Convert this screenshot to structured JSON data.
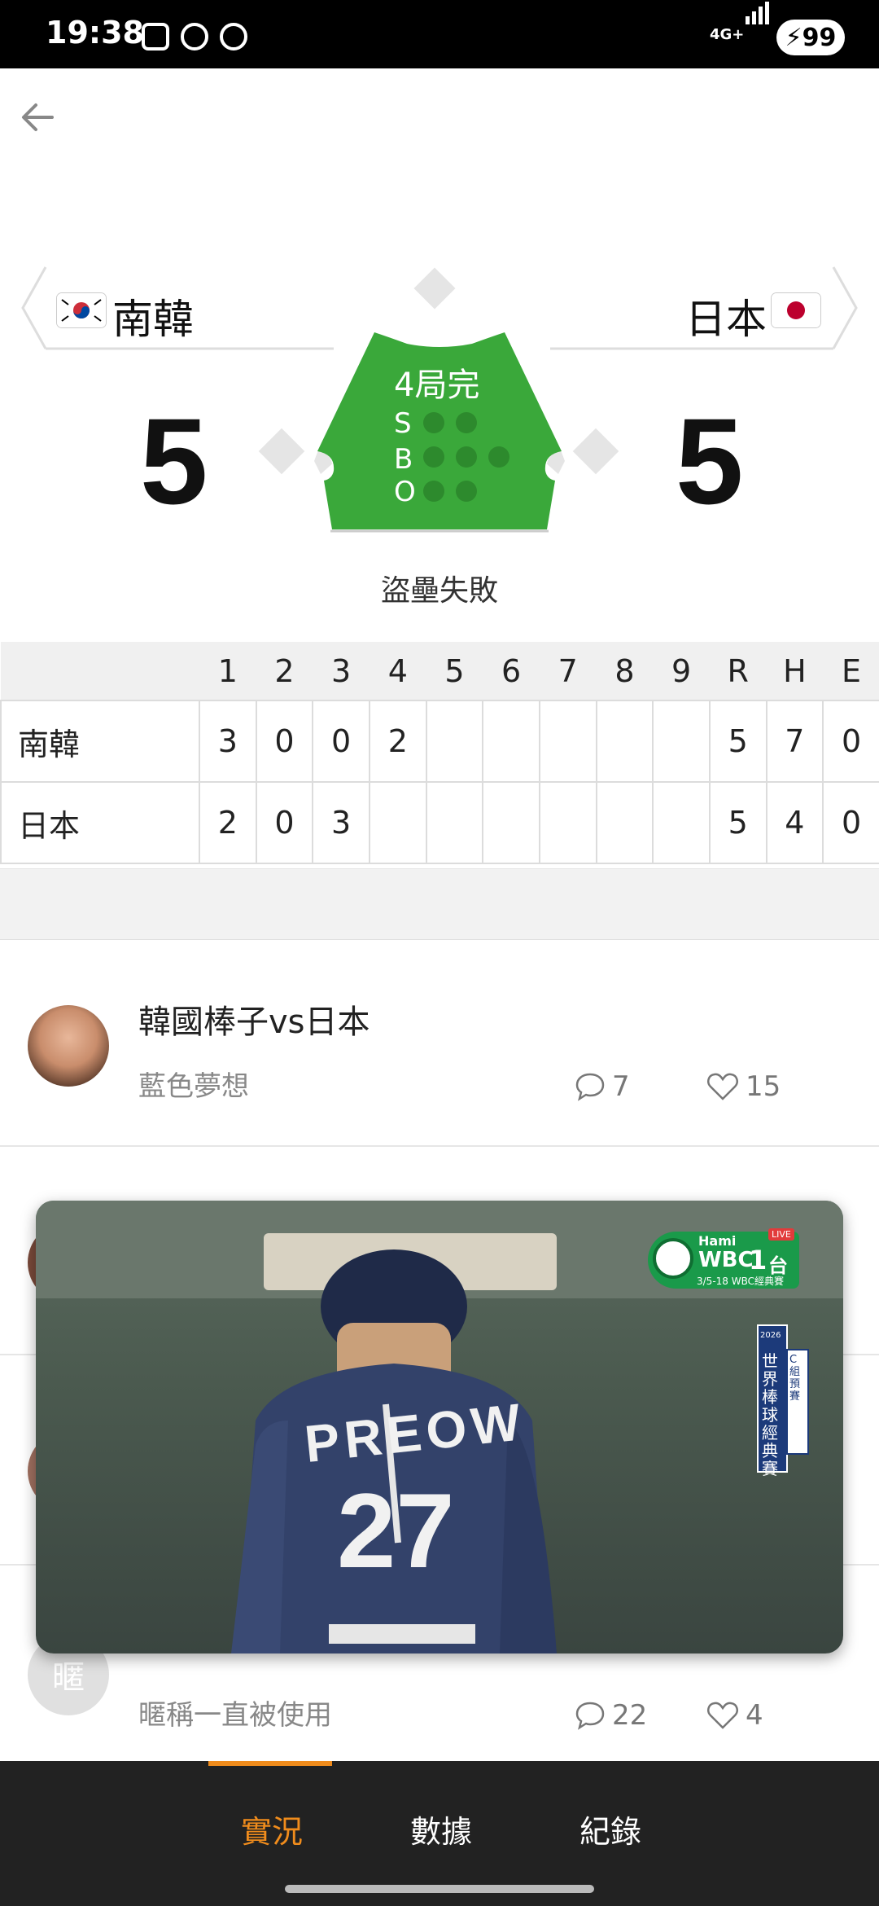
{
  "status_bar": {
    "time": "19:38",
    "network": "4G+",
    "battery": "99"
  },
  "matchup": {
    "home": {
      "name": "南韓",
      "score": "5",
      "flag": "korea-flag"
    },
    "away": {
      "name": "日本",
      "score": "5",
      "flag": "japan-flag"
    },
    "inning_status": "4局完",
    "sbo": {
      "s_label": "S",
      "b_label": "B",
      "o_label": "O",
      "strikes": 0,
      "balls": 0,
      "outs": 0
    },
    "play_status": "盜壘失敗"
  },
  "linescore": {
    "headers": [
      "1",
      "2",
      "3",
      "4",
      "5",
      "6",
      "7",
      "8",
      "9",
      "R",
      "H",
      "E"
    ],
    "rows": [
      {
        "team": "南韓",
        "cells": [
          "3",
          "0",
          "0",
          "2",
          "",
          "",
          "",
          "",
          "",
          "5",
          "7",
          "0"
        ]
      },
      {
        "team": "日本",
        "cells": [
          "2",
          "0",
          "3",
          "",
          "",
          "",
          "",
          "",
          "",
          "5",
          "4",
          "0"
        ]
      }
    ]
  },
  "posts": [
    {
      "title": "韓國棒子vs日本",
      "author": "藍色夢想",
      "comments": "7",
      "likes": "15",
      "avatar": "photo"
    },
    {
      "title": "",
      "author": "暱稱一直被使用",
      "comments": "22",
      "likes": "4",
      "avatar_text": "暱"
    }
  ],
  "video": {
    "channel_brand": "Hami",
    "channel_name": "WBC",
    "channel_number": "1",
    "channel_suffix": "台",
    "live_badge": "LIVE",
    "date_line": "3/5-18 WBC經典賽",
    "event_year": "2026",
    "event_name": "世界棒球經典賽",
    "group": "C組預賽",
    "jersey_text": "PREOW",
    "jersey_number": "27"
  },
  "bottom_nav": {
    "tabs": [
      "實況",
      "數據",
      "紀錄"
    ],
    "active": 0
  },
  "colors": {
    "accent": "#f08c1c",
    "diamond_green": "#3aa83a",
    "nav_bg": "#222222"
  }
}
